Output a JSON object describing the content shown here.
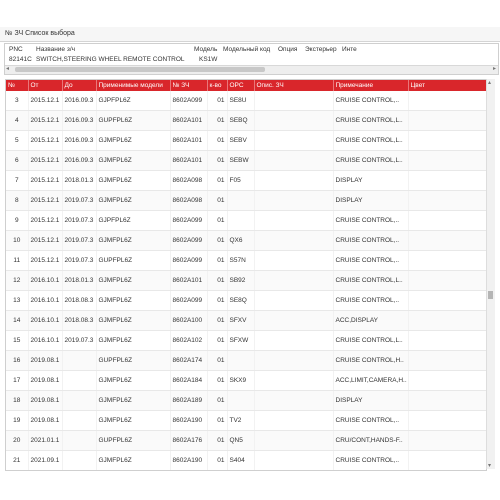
{
  "window": {
    "title": "№ ЗЧ Список выбора"
  },
  "part_info": {
    "headers": [
      "PNC",
      "Название з/ч",
      "Модель",
      "Модельный код",
      "Опция",
      "Экстерьер",
      "Инте"
    ],
    "pnc": "82141C",
    "name": "SWITCH,STEERING WHEEL REMOTE CONTROL",
    "model": "KS1W"
  },
  "table": {
    "columns": [
      "№",
      "От",
      "До",
      "Применимые модели",
      "№ ЗЧ",
      "к-во",
      "ОРС",
      "Опис. ЗЧ",
      "Примечание",
      "Цвет"
    ],
    "rows": [
      [
        "3",
        "2015.12.1",
        "2016.09.3",
        "GJPFPL6Z",
        "8602A099",
        "01",
        "SE8U",
        "",
        "CRUISE CONTROL,..",
        ""
      ],
      [
        "4",
        "2015.12.1",
        "2016.09.3",
        "GUPFPL6Z",
        "8602A101",
        "01",
        "SEBQ",
        "",
        "CRUISE CONTROL,L..",
        ""
      ],
      [
        "5",
        "2015.12.1",
        "2016.09.3",
        "GJMFPL6Z",
        "8602A101",
        "01",
        "SEBV",
        "",
        "CRUISE CONTROL,L..",
        ""
      ],
      [
        "6",
        "2015.12.1",
        "2016.09.3",
        "GJMFPL6Z",
        "8602A101",
        "01",
        "SEBW",
        "",
        "CRUISE CONTROL,L..",
        ""
      ],
      [
        "7",
        "2015.12.1",
        "2018.01.3",
        "GJMFPL6Z",
        "8602A098",
        "01",
        "F05",
        "",
        "DISPLAY",
        ""
      ],
      [
        "8",
        "2015.12.1",
        "2019.07.3",
        "GJMFPL6Z",
        "8602A098",
        "01",
        "",
        "",
        "DISPLAY",
        ""
      ],
      [
        "9",
        "2015.12.1",
        "2019.07.3",
        "GJPFPL6Z",
        "8602A099",
        "01",
        "",
        "",
        "CRUISE CONTROL,..",
        ""
      ],
      [
        "10",
        "2015.12.1",
        "2019.07.3",
        "GJMFPL6Z",
        "8602A099",
        "01",
        "QX6",
        "",
        "CRUISE CONTROL,..",
        ""
      ],
      [
        "11",
        "2015.12.1",
        "2019.07.3",
        "GUPFPL6Z",
        "8602A099",
        "01",
        "S57N",
        "",
        "CRUISE CONTROL,..",
        ""
      ],
      [
        "12",
        "2016.10.1",
        "2018.01.3",
        "GJMFPL6Z",
        "8602A101",
        "01",
        "SB92",
        "",
        "CRUISE CONTROL,L..",
        ""
      ],
      [
        "13",
        "2016.10.1",
        "2018.08.3",
        "GJMFPL6Z",
        "8602A099",
        "01",
        "SE8Q",
        "",
        "CRUISE CONTROL,..",
        ""
      ],
      [
        "14",
        "2016.10.1",
        "2018.08.3",
        "GJMFPL6Z",
        "8602A100",
        "01",
        "SFXV",
        "",
        "ACC,DISPLAY",
        ""
      ],
      [
        "15",
        "2016.10.1",
        "2019.07.3",
        "GJMFPL6Z",
        "8602A102",
        "01",
        "SFXW",
        "",
        "CRUISE CONTROL,L..",
        ""
      ],
      [
        "16",
        "2019.08.1",
        "",
        "GUPFPL6Z",
        "8602A174",
        "01",
        "",
        "",
        "CRUISE CONTROL,H..",
        ""
      ],
      [
        "17",
        "2019.08.1",
        "",
        "GJMFPL6Z",
        "8602A184",
        "01",
        "SKX9",
        "",
        "ACC,LIMIT,CAMERA,H..",
        ""
      ],
      [
        "18",
        "2019.08.1",
        "",
        "GJMFPL6Z",
        "8602A189",
        "01",
        "",
        "",
        "DISPLAY",
        ""
      ],
      [
        "19",
        "2019.08.1",
        "",
        "GJMFPL6Z",
        "8602A190",
        "01",
        "TV2",
        "",
        "CRUISE CONTROL,..",
        ""
      ],
      [
        "20",
        "2021.01.1",
        "",
        "GUPFPL6Z",
        "8602A176",
        "01",
        "QN5",
        "",
        "CRU/CONT,HANDS-F..",
        ""
      ],
      [
        "21",
        "2021.09.1",
        "",
        "GJMFPL6Z",
        "8602A190",
        "01",
        "S404",
        "",
        "CRUISE CONTROL,..",
        ""
      ]
    ]
  },
  "icons": {
    "scroll_left": "triangle-left",
    "scroll_right": "triangle-right",
    "scroll_up": "triangle-up",
    "scroll_down": "triangle-down"
  },
  "colors": {
    "header_bg": "#d9262b",
    "header_text": "#ffffff"
  }
}
